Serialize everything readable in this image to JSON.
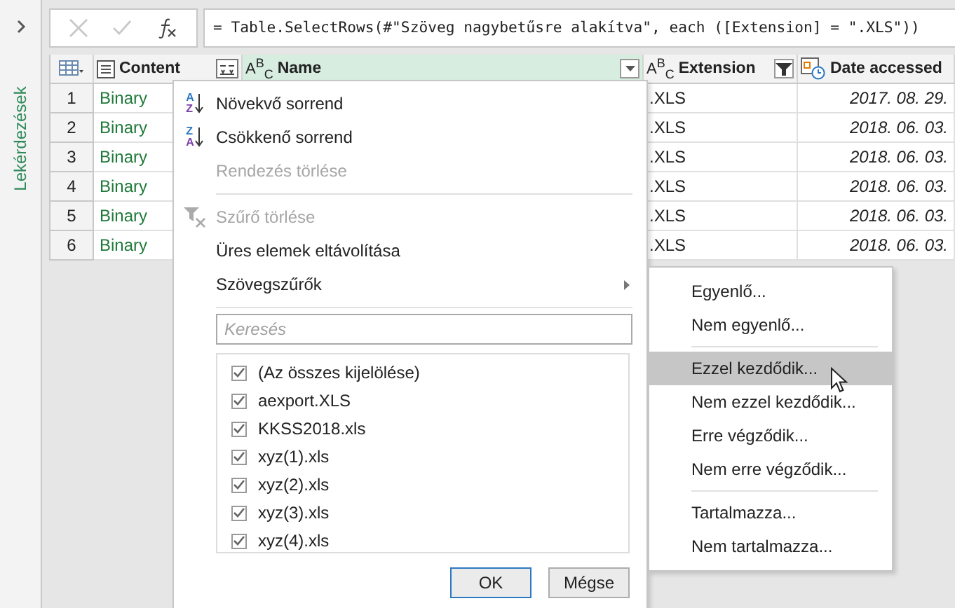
{
  "sidebar": {
    "label": "Lekérdezések"
  },
  "formula_bar": {
    "formula": "= Table.SelectRows(#\"Szöveg nagybetűsre alakítva\", each ([Extension] = \".XLS\"))"
  },
  "table": {
    "columns": [
      {
        "label": "Content",
        "kind": "binary",
        "selected": false,
        "filtered": false
      },
      {
        "label": "Name",
        "kind": "text",
        "type_label": "A$^{B}$$_{C}$",
        "selected": true,
        "filtered": false
      },
      {
        "label": "Extension",
        "kind": "text",
        "type_label": "A$^{B}$$_{C}$",
        "selected": false,
        "filtered": true
      },
      {
        "label": "Date accessed",
        "kind": "datetime",
        "selected": false,
        "filtered": false
      }
    ],
    "rows": [
      {
        "number": "1",
        "content": "Binary",
        "extension": ".XLS",
        "date_accessed": "2017. 08. 29."
      },
      {
        "number": "2",
        "content": "Binary",
        "extension": ".XLS",
        "date_accessed": "2018. 06. 03."
      },
      {
        "number": "3",
        "content": "Binary",
        "extension": ".XLS",
        "date_accessed": "2018. 06. 03."
      },
      {
        "number": "4",
        "content": "Binary",
        "extension": ".XLS",
        "date_accessed": "2018. 06. 03."
      },
      {
        "number": "5",
        "content": "Binary",
        "extension": ".XLS",
        "date_accessed": "2018. 06. 03."
      },
      {
        "number": "6",
        "content": "Binary",
        "extension": ".XLS",
        "date_accessed": "2018. 06. 03."
      }
    ]
  },
  "column_menu": {
    "items": [
      {
        "kind": "sort",
        "label": "Növekvő sorrend",
        "icon_letters": [
          "A",
          "Z"
        ],
        "disabled": false
      },
      {
        "kind": "sort",
        "label": "Csökkenő sorrend",
        "icon_letters": [
          "Z",
          "A"
        ],
        "disabled": false
      },
      {
        "kind": "plain",
        "label": "Rendezés törlése",
        "disabled": true
      },
      {
        "kind": "separator"
      },
      {
        "kind": "clear-filter",
        "label": "Szűrő törlése",
        "disabled": true
      },
      {
        "kind": "plain",
        "label": "Üres elemek eltávolítása",
        "disabled": false
      },
      {
        "kind": "submenu",
        "label": "Szövegszűrők",
        "disabled": false
      },
      {
        "kind": "separator"
      }
    ],
    "search": {
      "placeholder": "Keresés"
    },
    "values": [
      {
        "label": "(Az összes kijelölése)",
        "checked": true
      },
      {
        "label": "aexport.XLS",
        "checked": true
      },
      {
        "label": "KKSS2018.xls",
        "checked": true
      },
      {
        "label": "xyz(1).xls",
        "checked": true
      },
      {
        "label": "xyz(2).xls",
        "checked": true
      },
      {
        "label": "xyz(3).xls",
        "checked": true
      },
      {
        "label": "xyz(4).xls",
        "checked": true
      }
    ],
    "buttons": [
      "OK",
      "Mégse"
    ]
  },
  "text_filters_menu": {
    "groups": [
      [
        {
          "label": "Egyenlő...",
          "selected": false
        },
        {
          "label": "Nem egyenlő...",
          "selected": false
        }
      ],
      [
        {
          "label": "Ezzel kezdődik...",
          "selected": true
        },
        {
          "label": "Nem ezzel kezdődik...",
          "selected": false
        },
        {
          "label": "Erre végződik...",
          "selected": false
        },
        {
          "label": "Nem erre végződik...",
          "selected": false
        }
      ],
      [
        {
          "label": "Tartalmazza...",
          "selected": false
        },
        {
          "label": "Nem tartalmazza...",
          "selected": false
        }
      ]
    ]
  }
}
